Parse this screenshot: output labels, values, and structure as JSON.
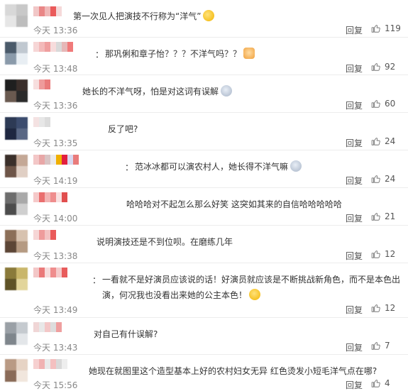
{
  "comments": [
    {
      "text": "第一次见人把演技不行称为“洋气”",
      "has_colon": false,
      "emoji": "grinning-tongue-emoji",
      "time": "今天 13:36",
      "reply": "回复",
      "likes": "119",
      "avatar_colors": [
        "#d8d8d8",
        "#c8c8c8",
        "#e6e6e6",
        "#bdbdbd"
      ],
      "name_colors": [
        "#f1c7c7",
        "#e98686",
        "#f0b8b8",
        "#ea5a5a",
        "#f5d9d9"
      ]
    },
    {
      "text": "那巩俐和章子怡？？？不洋气吗？？",
      "has_colon": true,
      "emoji": "cat-face-emoji",
      "time": "今天 13:48",
      "reply": "回复",
      "likes": "92",
      "avatar_colors": [
        "#4a5a6a",
        "#c0c8d0",
        "#8a9aaa",
        "#e8eef3"
      ],
      "name_colors": [
        "#f6d6d6",
        "#f3b9b9",
        "#ef9f9f",
        "#f7dcdc",
        "#d9d9d9",
        "#e6b7b7",
        "#f07a7a"
      ]
    },
    {
      "text": "她长的不洋气呀，怕是对这词有误解",
      "has_colon": false,
      "emoji": "grimace-emoji",
      "time": "今天 13:36",
      "reply": "回复",
      "likes": "60",
      "avatar_colors": [
        "#1f1f1f",
        "#3a2e2a",
        "#6a5a50",
        "#2a2a2a"
      ],
      "name_colors": [
        "#f7dede",
        "#ee9b9b",
        "#e97b7b"
      ]
    },
    {
      "text": "反了吧?",
      "has_colon": false,
      "emoji": "",
      "time": "今天 13:35",
      "reply": "回复",
      "likes": "24",
      "avatar_colors": [
        "#2d3a55",
        "#3c4c6e",
        "#1e2740",
        "#596784"
      ],
      "name_colors": [
        "#f4e2e2",
        "#e7e7e7",
        "#dcdcdc"
      ]
    },
    {
      "text": "范冰冰都可以演农村人，她长得不洋气嘛",
      "has_colon": true,
      "emoji": "grimace-emoji",
      "time": "今天 14:19",
      "reply": "回复",
      "likes": "24",
      "avatar_colors": [
        "#3a2f2a",
        "#c4a896",
        "#6e5548",
        "#e0cfc4"
      ],
      "name_colors": [
        "#f3c7c7",
        "#e8a7a7",
        "#d9c4c4",
        "#ebebeb",
        "#f0b000",
        "#e21f3f",
        "#d8d8f0",
        "#e97b7b"
      ]
    },
    {
      "text": "哈哈哈对不起怎么那么好笑 这突如其来的自信哈哈哈哈哈",
      "has_colon": false,
      "emoji": "",
      "time": "今天 14:00",
      "reply": "回复",
      "likes": "21",
      "avatar_colors": [
        "#6d6d6d",
        "#a9a9a9",
        "#4c4c4c",
        "#cfcfcf"
      ],
      "name_colors": [
        "#f5c9c9",
        "#ea6f6f",
        "#f2b4b4",
        "#ef8d8d",
        "#f9e0e0",
        "#e14e4e"
      ]
    },
    {
      "text": "说明演技还是不到位呗。在磨练几年",
      "has_colon": false,
      "emoji": "",
      "time": "今天 13:38",
      "reply": "回复",
      "likes": "12",
      "avatar_colors": [
        "#8c6f58",
        "#d7c2af",
        "#5c4636",
        "#b59a82"
      ],
      "name_colors": [
        "#f6d6d6",
        "#ee9c9c",
        "#f3c3c3",
        "#ea5a5a"
      ]
    },
    {
      "text": "一看就不是好演员应该说的话！好演员就应该是不断挑战新角色，而不是本色出演，何况我也没看出来她的公主本色！",
      "has_colon": true,
      "emoji": "thinking-emoji",
      "time": "今天 13:49",
      "reply": "回复",
      "likes": "12",
      "avatar_colors": [
        "#8a7a3a",
        "#c9b66a",
        "#5e5226",
        "#e2d59b"
      ],
      "name_colors": [
        "#f3c7c7",
        "#ea7a7a",
        "#f7dcdc",
        "#ef8d8d",
        "#f5cbcb",
        "#e85c5c"
      ]
    },
    {
      "text": "对自己有什误解?",
      "has_colon": false,
      "emoji": "",
      "time": "今天 13:43",
      "reply": "回复",
      "likes": "7",
      "avatar_colors": [
        "#9aa0a6",
        "#c5cacf",
        "#7f868c",
        "#e3e6e9"
      ],
      "name_colors": [
        "#f0d6d6",
        "#e8e8e8",
        "#f3c7c7",
        "#dddddd",
        "#ef9f9f"
      ]
    },
    {
      "text": "她现在就图里这个造型基本上好的农村妇女无异 红色烫发小短毛洋气点在哪?",
      "has_colon": false,
      "emoji": "",
      "time": "今天 15:56",
      "reply": "回复",
      "likes": "4",
      "avatar_colors": [
        "#b99a84",
        "#e6d3c4",
        "#8a6b58",
        "#f1e6dd"
      ],
      "name_colors": [
        "#f6d0d0",
        "#f0b2b2",
        "#e9e9e9",
        "#f4c0c0",
        "#d9d9d9",
        "#eeeeee"
      ]
    }
  ],
  "layout": {
    "icons": {
      "like": "thumbs-up-icon"
    },
    "colors": {
      "text": "#333333",
      "muted": "#888888",
      "divider": "#ececec"
    }
  }
}
